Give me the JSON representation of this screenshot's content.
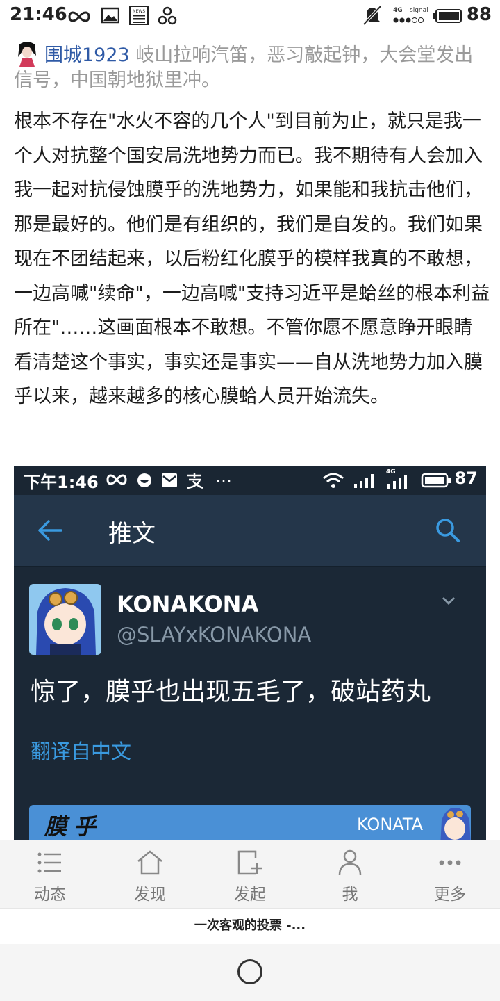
{
  "status_bar": {
    "time": "21:46",
    "network_label": "4G",
    "signal_label": "signal",
    "battery": "88",
    "news_icon_text": "NEWS"
  },
  "post": {
    "username": "围城1923",
    "header_text": "岐山拉响汽笛，恶习敲起钟，大会堂发出信号，中国朝地狱里冲。",
    "body": "根本不存在\"水火不容的几个人\"到目前为止，就只是我一个人对抗整个国安局洗地势力而已。我不期待有人会加入我一起对抗侵蚀膜乎的洗地势力，如果能和我抗击他们，那是最好的。他们是有组织的，我们是自发的。我们如果现在不团结起来，以后粉红化膜乎的模样我真的不敢想，一边高喊\"续命\"，一边高喊\"支持习近平是蛤丝的根本利益所在\"……这画面根本不敢想。不管你愿不愿意睁开眼睛看清楚这个事实，事实还是事实——自从洗地势力加入膜乎以来，越来越多的核心膜蛤人员开始流失。"
  },
  "embedded": {
    "status_time": "下午1:46",
    "status_extra": "…",
    "status_net": "4G",
    "battery": "87",
    "header_title": "推文",
    "tweet_name": "KONAKONA",
    "tweet_handle": "@SLAYxKONAKONA",
    "tweet_text": "惊了，膜乎也出现五毛了，破站药丸",
    "translate_label": "翻译自中文",
    "card_left": "膜乎",
    "card_right": "KONATA"
  },
  "nav": {
    "items": [
      {
        "label": "动态",
        "icon": "list-icon"
      },
      {
        "label": "发现",
        "icon": "home-icon"
      },
      {
        "label": "发起",
        "icon": "compose-icon"
      },
      {
        "label": "我",
        "icon": "user-icon"
      },
      {
        "label": "更多",
        "icon": "more-icon"
      }
    ]
  },
  "banner": {
    "text": "一次客观的投票 -..."
  },
  "colors": {
    "accent_blue": "#2f5aa6",
    "twitter_bg": "#1b2836",
    "twitter_header": "#24364a",
    "twitter_link": "#3a9ae0"
  }
}
